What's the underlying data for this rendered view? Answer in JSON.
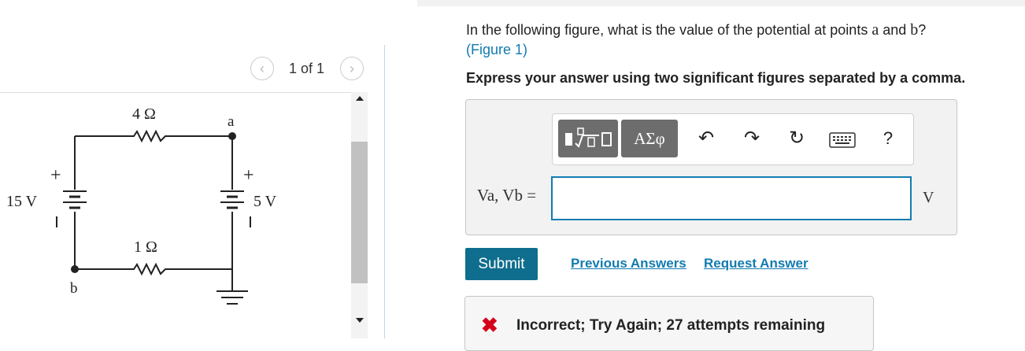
{
  "figure_panel": {
    "pager_text": "1 of 1",
    "prev_icon": "chevron-left-icon",
    "next_icon": "chevron-right-icon",
    "circuit": {
      "r_top": "4 Ω",
      "r_bottom": "1 Ω",
      "v_left": "15 V",
      "v_right": "5 V",
      "node_a": "a",
      "node_b": "b",
      "plus": "+"
    }
  },
  "question": {
    "text_before": "In the following figure, what is the value of the potential at points ",
    "point_a": "a",
    "text_and": " and ",
    "point_b": "b",
    "text_q": "?",
    "figure_link_open": "(",
    "figure_link": "Figure 1",
    "figure_link_close": ")",
    "instruction": "Express your answer using two significant figures separated by a comma."
  },
  "toolbar": {
    "templates_icon": "sqrt-template-icon",
    "greek_label": "ΑΣφ",
    "undo_icon": "undo-icon",
    "redo_icon": "redo-icon",
    "reset_icon": "reset-icon",
    "keyboard_icon": "keyboard-icon",
    "help_label": "?"
  },
  "answer": {
    "label": "Va, Vb =",
    "value": "",
    "unit": "V"
  },
  "actions": {
    "submit_label": "Submit",
    "previous_answers": "Previous Answers",
    "request_answer": "Request Answer"
  },
  "feedback": {
    "icon": "x-icon",
    "message": "Incorrect; Try Again; 27 attempts remaining"
  },
  "colors": {
    "accent": "#137bb0",
    "submit_bg": "#0f6e8d",
    "error": "#d5001a"
  }
}
